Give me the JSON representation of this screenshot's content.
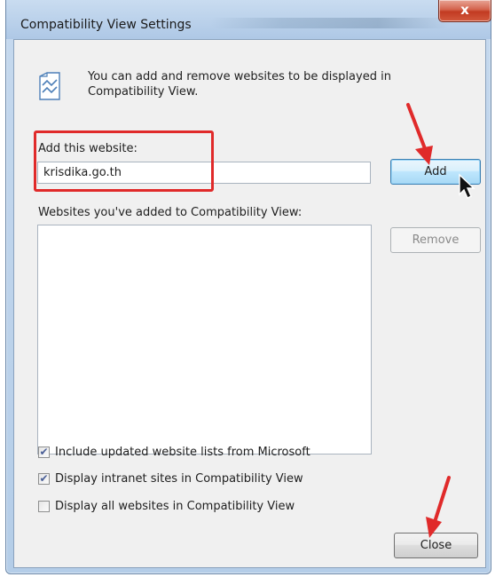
{
  "window": {
    "title": "Compatibility View Settings",
    "close_glyph": "x"
  },
  "info": {
    "icon": "compatibility-view-icon",
    "text": "You can add and remove websites to be displayed in Compatibility View."
  },
  "add_section": {
    "label": "Add this website:",
    "input_value": "krisdika.go.th",
    "add_button": "Add"
  },
  "list_section": {
    "label": "Websites you've added to Compatibility View:",
    "items": [],
    "remove_button": "Remove"
  },
  "options": [
    {
      "label": "Include updated website lists from Microsoft",
      "checked": true
    },
    {
      "label": "Display intranet sites in Compatibility View",
      "checked": true
    },
    {
      "label": "Display all websites in Compatibility View",
      "checked": false
    }
  ],
  "footer": {
    "close_button": "Close"
  },
  "annotations": {
    "highlight_color": "#e02a2a",
    "arrow_color": "#e02a2a"
  }
}
